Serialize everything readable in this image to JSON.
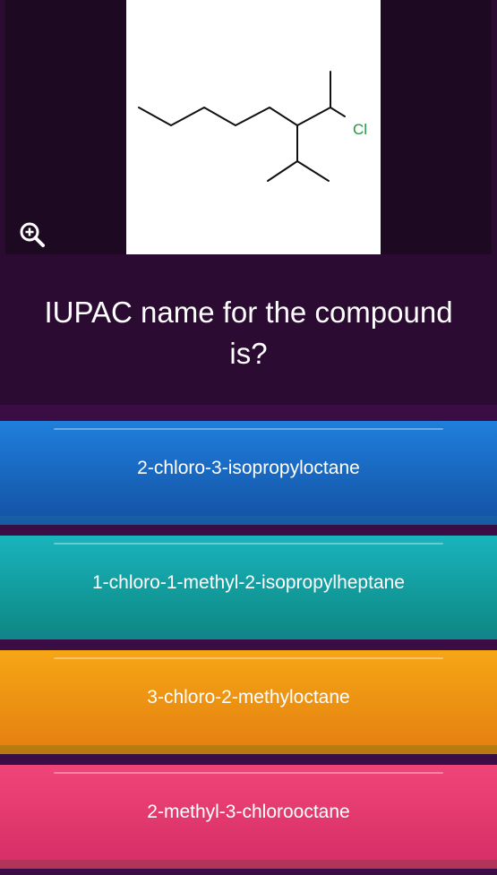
{
  "question": {
    "line1": "IUPAC name for the compound",
    "line2": "is?"
  },
  "molecule": {
    "atom_label": "Cl",
    "label_color": "#1f9a3a"
  },
  "zoom_icon": "zoom-in-icon",
  "options": [
    {
      "label": "2-chloro-3-isopropyloctane",
      "color": "#1a6ac4"
    },
    {
      "label": "1-chloro-1-methyl-2-isopropylheptane",
      "color": "#14a3a8"
    },
    {
      "label": "3-chloro-2-methyloctane",
      "color": "#f09413"
    },
    {
      "label": "2-methyl-3-chlorooctane",
      "color": "#e53a70"
    }
  ]
}
